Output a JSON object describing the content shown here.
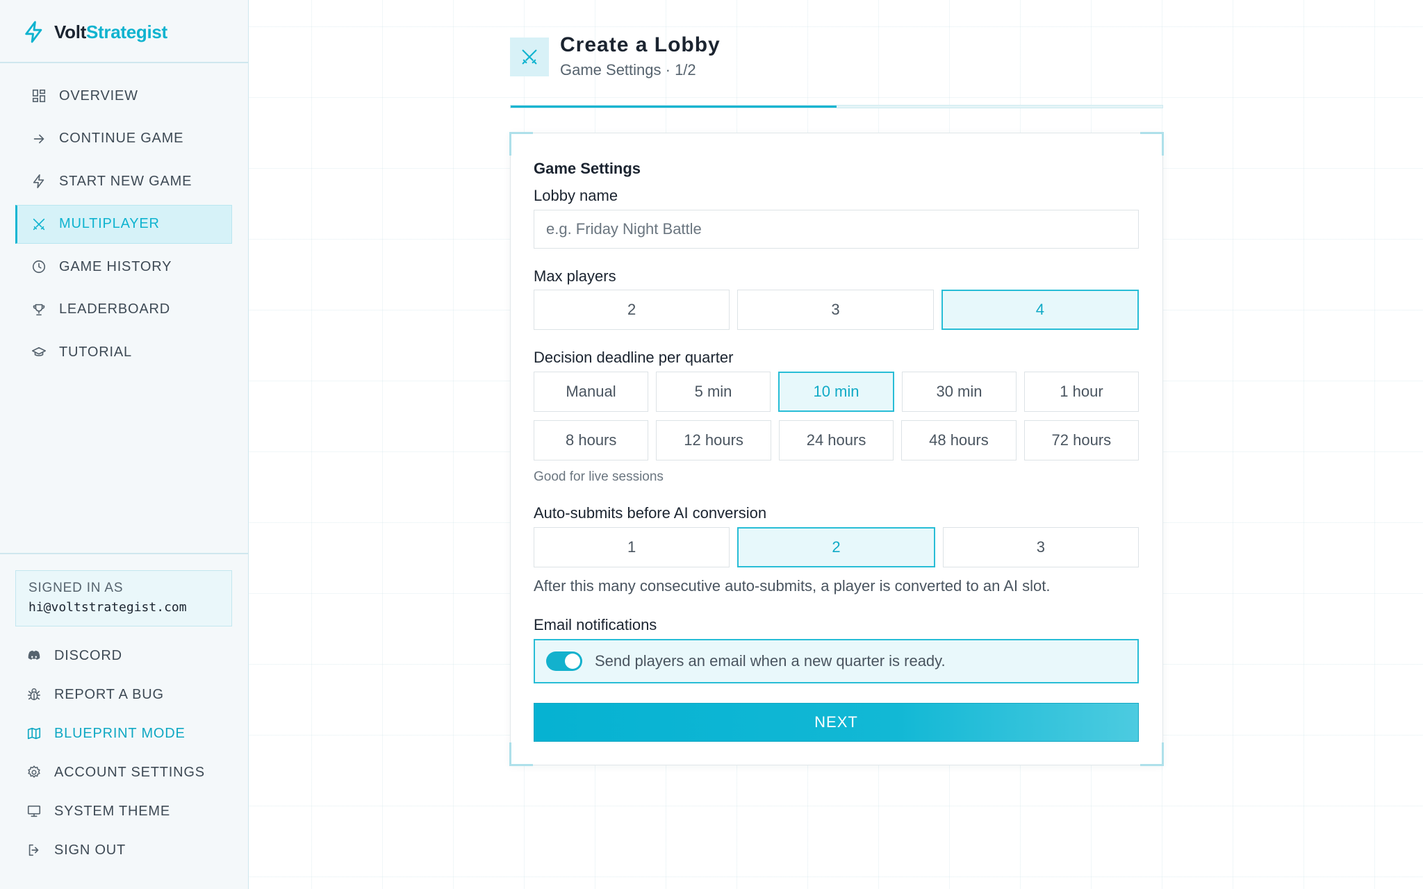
{
  "brand": {
    "name_part1": "Volt",
    "name_part2": "Strategist",
    "accent": "#0fb3cf"
  },
  "sidebar": {
    "items": [
      {
        "label": "OVERVIEW",
        "icon": "grid-icon"
      },
      {
        "label": "CONTINUE GAME",
        "icon": "arrow-right-icon"
      },
      {
        "label": "START NEW GAME",
        "icon": "bolt-icon"
      },
      {
        "label": "MULTIPLAYER",
        "icon": "crossed-swords-icon",
        "active": true
      },
      {
        "label": "GAME HISTORY",
        "icon": "clock-icon"
      },
      {
        "label": "LEADERBOARD",
        "icon": "trophy-icon"
      },
      {
        "label": "TUTORIAL",
        "icon": "graduation-cap-icon"
      }
    ],
    "signed_in_label": "SIGNED IN AS",
    "signed_in_email": "hi@voltstrategist.com",
    "bottom_items": [
      {
        "label": "DISCORD",
        "icon": "discord-icon"
      },
      {
        "label": "REPORT A BUG",
        "icon": "bug-icon"
      },
      {
        "label": "BLUEPRINT MODE",
        "icon": "map-icon",
        "accent": true
      },
      {
        "label": "ACCOUNT SETTINGS",
        "icon": "gear-icon"
      },
      {
        "label": "SYSTEM THEME",
        "icon": "monitor-icon"
      },
      {
        "label": "SIGN OUT",
        "icon": "sign-out-icon"
      }
    ]
  },
  "header": {
    "title": "Create a Lobby",
    "subtitle": "Game Settings · 1/2",
    "icon": "crossed-swords-icon",
    "progress": 0.5
  },
  "form": {
    "section_title": "Game Settings",
    "lobby_name_label": "Lobby name",
    "lobby_name_value": "",
    "lobby_name_placeholder": "e.g. Friday Night Battle",
    "max_players_label": "Max players",
    "max_players_options": [
      "2",
      "3",
      "4"
    ],
    "max_players_selected": "4",
    "deadline_label": "Decision deadline per quarter",
    "deadline_options_row1": [
      "Manual",
      "5 min",
      "10 min",
      "30 min",
      "1 hour"
    ],
    "deadline_options_row2": [
      "8 hours",
      "12 hours",
      "24 hours",
      "48 hours",
      "72 hours"
    ],
    "deadline_selected": "10 min",
    "deadline_hint": "Good for live sessions",
    "auto_submit_label": "Auto-submits before AI conversion",
    "auto_submit_options": [
      "1",
      "2",
      "3"
    ],
    "auto_submit_selected": "2",
    "auto_submit_desc": "After this many consecutive auto-submits, a player is converted to an AI slot.",
    "email_label": "Email notifications",
    "email_toggle_text": "Send players an email when a new quarter is ready.",
    "email_enabled": true,
    "next_label": "NEXT"
  }
}
